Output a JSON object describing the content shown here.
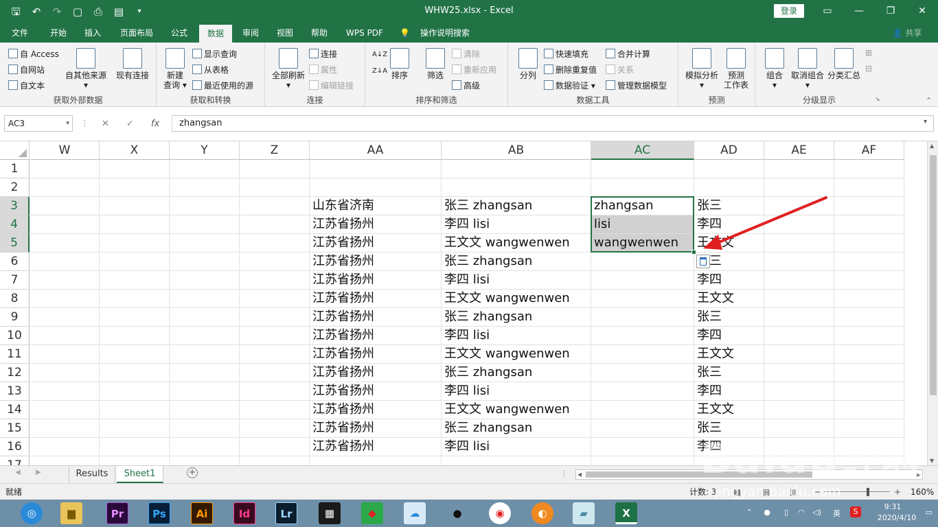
{
  "title_bar": {
    "title": "WHW25.xlsx  -  Excel",
    "login": "登录",
    "qat_icons": [
      "save-icon",
      "undo-icon",
      "redo-icon",
      "new-icon",
      "print-preview-icon",
      "form-icon",
      "customize-icon"
    ]
  },
  "tabs": [
    "文件",
    "开始",
    "插入",
    "页面布局",
    "公式",
    "数据",
    "审阅",
    "视图",
    "帮助",
    "WPS PDF",
    "操作说明搜索"
  ],
  "active_tab": "数据",
  "share": "共享",
  "ribbon": {
    "get_external": {
      "access": "自 Access",
      "web": "自网站",
      "text": "自文本",
      "other": "自其他来源",
      "existing": "现有连接",
      "label": "获取外部数据"
    },
    "transform": {
      "new_query": "新建",
      "new_query2": "查询",
      "show": "显示查询",
      "from_table": "从表格",
      "recent": "最近使用的源",
      "label": "获取和转换"
    },
    "connections": {
      "refresh": "全部刷新",
      "conn": "连接",
      "props": "属性",
      "edit_links": "编辑链接",
      "label": "连接"
    },
    "sort_filter": {
      "sort": "排序",
      "filter": "筛选",
      "clear": "清除",
      "reapply": "重新应用",
      "advanced": "高级",
      "label": "排序和筛选"
    },
    "data_tools": {
      "split": "分列",
      "flash": "快速填充",
      "remove_dup": "删除重复值",
      "validate": "数据验证",
      "consolidate": "合并计算",
      "relations": "关系",
      "model": "管理数据模型",
      "label": "数据工具"
    },
    "forecast": {
      "whatif": "模拟分析",
      "sheet1": "预测",
      "sheet2": "工作表",
      "label": "预测"
    },
    "outline": {
      "group": "组合",
      "ungroup": "取消组合",
      "subtotal": "分类汇总",
      "label": "分级显示"
    }
  },
  "formula_bar": {
    "name_box": "AC3",
    "fx": "fx",
    "value": "zhangsan"
  },
  "columns": [
    "W",
    "X",
    "Y",
    "Z",
    "AA",
    "AB",
    "AC",
    "AD",
    "AE",
    "AF"
  ],
  "selected_column": "AC",
  "rows": [
    {
      "n": "1",
      "AA": "",
      "AB": "",
      "AC": "",
      "AD": ""
    },
    {
      "n": "2",
      "AA": "",
      "AB": "",
      "AC": "",
      "AD": ""
    },
    {
      "n": "3",
      "AA": "山东省济南",
      "AB": "张三 zhangsan",
      "AC": "zhangsan",
      "AD": "张三"
    },
    {
      "n": "4",
      "AA": "江苏省扬州",
      "AB": "李四 lisi",
      "AC": "lisi",
      "AD": "李四"
    },
    {
      "n": "5",
      "AA": "江苏省扬州",
      "AB": "王文文 wangwenwen",
      "AC": "wangwenwen",
      "AD": "王文文"
    },
    {
      "n": "6",
      "AA": "江苏省扬州",
      "AB": "张三 zhangsan",
      "AC": "",
      "AD": "张三"
    },
    {
      "n": "7",
      "AA": "江苏省扬州",
      "AB": "李四 lisi",
      "AC": "",
      "AD": "李四"
    },
    {
      "n": "8",
      "AA": "江苏省扬州",
      "AB": "王文文 wangwenwen",
      "AC": "",
      "AD": "王文文"
    },
    {
      "n": "9",
      "AA": "江苏省扬州",
      "AB": "张三 zhangsan",
      "AC": "",
      "AD": "张三"
    },
    {
      "n": "10",
      "AA": "江苏省扬州",
      "AB": "李四 lisi",
      "AC": "",
      "AD": "李四"
    },
    {
      "n": "11",
      "AA": "江苏省扬州",
      "AB": "王文文 wangwenwen",
      "AC": "",
      "AD": "王文文"
    },
    {
      "n": "12",
      "AA": "江苏省扬州",
      "AB": "张三 zhangsan",
      "AC": "",
      "AD": "张三"
    },
    {
      "n": "13",
      "AA": "江苏省扬州",
      "AB": "李四 lisi",
      "AC": "",
      "AD": "李四"
    },
    {
      "n": "14",
      "AA": "江苏省扬州",
      "AB": "王文文 wangwenwen",
      "AC": "",
      "AD": "王文文"
    },
    {
      "n": "15",
      "AA": "江苏省扬州",
      "AB": "张三 zhangsan",
      "AC": "",
      "AD": "张三"
    },
    {
      "n": "16",
      "AA": "江苏省扬州",
      "AB": "李四 lisi",
      "AC": "",
      "AD": "李四"
    },
    {
      "n": "17",
      "AA": "",
      "AB": "",
      "AC": "",
      "AD": ""
    }
  ],
  "sheets": [
    "Results",
    "Sheet1"
  ],
  "active_sheet": "Sheet1",
  "status": {
    "ready": "就绪",
    "count": "计数: 3",
    "zoom": "160%"
  },
  "taskbar": {
    "apps": [
      "browser-icon",
      "folder-icon",
      "Pr",
      "Ps",
      "Ai",
      "Id",
      "Lr",
      "video-icon",
      "paint-icon",
      "chat-icon",
      "qq-icon",
      "chrome-icon",
      "firefox-icon",
      "notebook-icon",
      "excel-icon"
    ],
    "time": "9:31",
    "date": "2020/4/10",
    "ime": "英"
  },
  "colors": {
    "accent": "#217346",
    "arrow": "#e02020"
  }
}
